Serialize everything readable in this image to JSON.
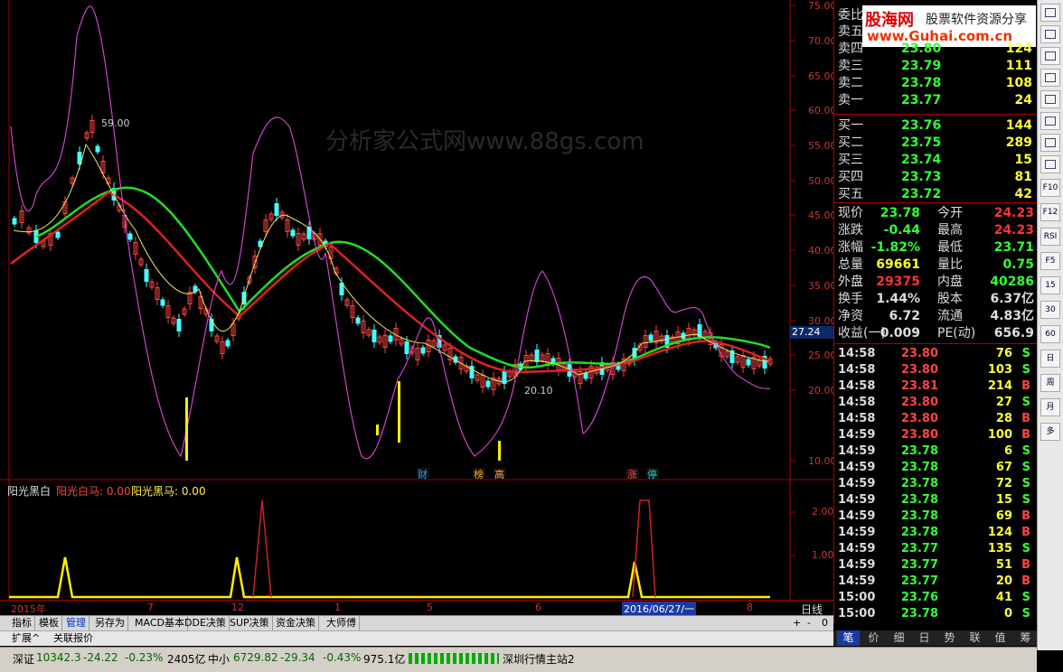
{
  "main_chart": {
    "price_axis": [
      "75.00",
      "70.00",
      "65.00",
      "60.00",
      "55.00",
      "50.00",
      "45.00",
      "40.00",
      "35.00",
      "30.00",
      "25.00",
      "20.00",
      "10.00"
    ],
    "current_price_tag": "27.24",
    "high_marker": "59.00",
    "low_marker": "20.10",
    "watermark": "分析家公式网www.88gs.com",
    "events": [
      "财",
      "榜",
      "高",
      "涨",
      "停"
    ]
  },
  "indicator": {
    "title": "阳光黑白",
    "line1": "阳光白马: 0.00",
    "line2": "阳光黑马: 0.00",
    "axis": [
      "2.00",
      "1.00"
    ]
  },
  "date_axis": [
    "2015年",
    "7",
    "12",
    "1",
    "5",
    "6",
    "2016/06/27/一",
    "8"
  ],
  "period": "日线",
  "tabs": [
    "指标",
    "模板",
    "管理",
    "另存为",
    "MACD基本",
    "DDE决策",
    "SUP决策",
    "资金决策",
    "大师傅"
  ],
  "subtabs": [
    "扩展^",
    "关联报价"
  ],
  "zoom_controls": [
    "+",
    "-",
    "0"
  ],
  "logo": {
    "name": "股海网",
    "slogan": "股票软件资源分享",
    "url": "www.Guhai.com.cn"
  },
  "order_book": {
    "header": "委比",
    "asks": [
      {
        "label": "卖五",
        "price": "",
        "vol": ""
      },
      {
        "label": "卖四",
        "price": "23.80",
        "vol": "124"
      },
      {
        "label": "卖三",
        "price": "23.79",
        "vol": "111"
      },
      {
        "label": "卖二",
        "price": "23.78",
        "vol": "108"
      },
      {
        "label": "卖一",
        "price": "23.77",
        "vol": "24"
      }
    ],
    "bids": [
      {
        "label": "买一",
        "price": "23.76",
        "vol": "144"
      },
      {
        "label": "买二",
        "price": "23.75",
        "vol": "289"
      },
      {
        "label": "买三",
        "price": "23.74",
        "vol": "15"
      },
      {
        "label": "买四",
        "price": "23.73",
        "vol": "81"
      },
      {
        "label": "买五",
        "price": "23.72",
        "vol": "42"
      }
    ]
  },
  "stats": [
    {
      "l1": "现价",
      "v1": "23.78",
      "c1": "#33ff33",
      "l2": "今开",
      "v2": "24.23",
      "c2": "#ff3333"
    },
    {
      "l1": "涨跌",
      "v1": "-0.44",
      "c1": "#33ff33",
      "l2": "最高",
      "v2": "24.23",
      "c2": "#ff3333"
    },
    {
      "l1": "涨幅",
      "v1": "-1.82%",
      "c1": "#33ff33",
      "l2": "最低",
      "v2": "23.71",
      "c2": "#33ff33"
    },
    {
      "l1": "总量",
      "v1": "69661",
      "c1": "#ffff33",
      "l2": "量比",
      "v2": "0.75",
      "c2": "#33ff33"
    },
    {
      "l1": "外盘",
      "v1": "29375",
      "c1": "#ff3333",
      "l2": "内盘",
      "v2": "40286",
      "c2": "#33ff33"
    },
    {
      "l1": "换手",
      "v1": "1.44%",
      "c1": "#dddddd",
      "l2": "股本",
      "v2": "6.37亿",
      "c2": "#dddddd"
    },
    {
      "l1": "净资",
      "v1": "6.72",
      "c1": "#dddddd",
      "l2": "流通",
      "v2": "4.83亿",
      "c2": "#dddddd"
    },
    {
      "l1": "收益(一)",
      "v1": "0.009",
      "c1": "#dddddd",
      "l2": "PE(动)",
      "v2": "656.9",
      "c2": "#dddddd"
    }
  ],
  "ticks": [
    {
      "t": "14:58",
      "p": "23.80",
      "v": "76",
      "s": "S"
    },
    {
      "t": "14:58",
      "p": "23.80",
      "v": "103",
      "s": "S"
    },
    {
      "t": "14:58",
      "p": "23.81",
      "v": "214",
      "s": "B"
    },
    {
      "t": "14:58",
      "p": "23.80",
      "v": "27",
      "s": "S"
    },
    {
      "t": "14:58",
      "p": "23.80",
      "v": "28",
      "s": "B"
    },
    {
      "t": "14:59",
      "p": "23.80",
      "v": "100",
      "s": "B"
    },
    {
      "t": "14:59",
      "p": "23.78",
      "v": "6",
      "s": "S"
    },
    {
      "t": "14:59",
      "p": "23.78",
      "v": "67",
      "s": "S"
    },
    {
      "t": "14:59",
      "p": "23.78",
      "v": "72",
      "s": "S"
    },
    {
      "t": "14:59",
      "p": "23.78",
      "v": "15",
      "s": "S"
    },
    {
      "t": "14:59",
      "p": "23.78",
      "v": "69",
      "s": "B"
    },
    {
      "t": "14:59",
      "p": "23.78",
      "v": "124",
      "s": "B"
    },
    {
      "t": "14:59",
      "p": "23.77",
      "v": "135",
      "s": "S"
    },
    {
      "t": "14:59",
      "p": "23.77",
      "v": "51",
      "s": "B"
    },
    {
      "t": "14:59",
      "p": "23.77",
      "v": "20",
      "s": "B"
    },
    {
      "t": "15:00",
      "p": "23.76",
      "v": "41",
      "s": "S"
    },
    {
      "t": "15:00",
      "p": "23.78",
      "v": "0",
      "s": "S"
    }
  ],
  "quote_tabs": [
    "笔",
    "价",
    "细",
    "日",
    "势",
    "联",
    "值",
    "筹"
  ],
  "sidebar_buttons": [
    "F10",
    "F12",
    "RSI",
    "F5",
    "15",
    "30",
    "60",
    "日",
    "周",
    "月",
    "多"
  ],
  "status": {
    "sz_name": "深证",
    "sz_val": "10342.3",
    "sz_chg": "-24.22",
    "sz_pct": "-0.23%",
    "sz_amt": "2405亿",
    "zx_name": "中小",
    "zx_val": "6729.82",
    "zx_chg": "-29.34",
    "zx_pct": "-0.43%",
    "zx_amt": "975.1亿",
    "server": "深圳行情主站2"
  }
}
